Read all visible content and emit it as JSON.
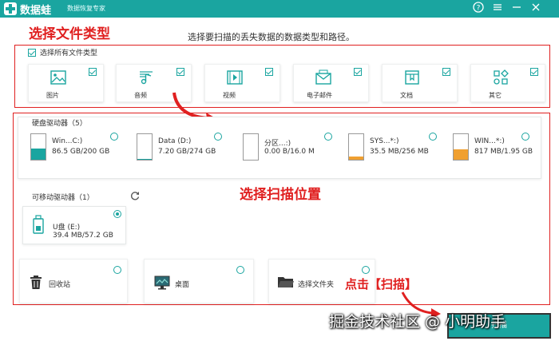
{
  "titlebar": {
    "app_name": "数据蛙",
    "subtitle": "数据恢复专家",
    "help_icon": "help-icon",
    "menu_icon": "menu-icon",
    "min_icon": "minimize-icon",
    "close_icon": "close-icon",
    "bg_color": "#1aa5a0"
  },
  "annotations": {
    "select_types": "选择文件类型",
    "select_location": "选择扫描位置",
    "click_scan": "点击【扫描】",
    "color": "#e02020"
  },
  "instruction": "选择要扫描的丢失数据的数据类型和路径。",
  "file_types": {
    "select_all_label": "选择所有文件类型",
    "select_all_checked": true,
    "items": [
      {
        "label": "图片",
        "icon": "image-icon",
        "checked": true
      },
      {
        "label": "音频",
        "icon": "music-icon",
        "checked": true
      },
      {
        "label": "视频",
        "icon": "video-icon",
        "checked": true
      },
      {
        "label": "电子邮件",
        "icon": "email-icon",
        "checked": true
      },
      {
        "label": "文档",
        "icon": "document-icon",
        "checked": true
      },
      {
        "label": "其它",
        "icon": "other-icon",
        "checked": true
      }
    ]
  },
  "hard_drives": {
    "title": "硬盘驱动器（5）",
    "items": [
      {
        "name": "Win...C:)",
        "size": "86.5 GB/200 GB",
        "used_fraction": 0.43,
        "fill_color": "#1aa5a0",
        "selected": false
      },
      {
        "name": "Data (D:)",
        "size": "7.20 GB/274 GB",
        "used_fraction": 0.03,
        "fill_color": "#1aa5a0",
        "selected": false
      },
      {
        "name": "分区...:)",
        "size": "0.00  B/16.0 M",
        "used_fraction": 0.0,
        "fill_color": "#f0a030",
        "selected": false
      },
      {
        "name": "SYS...*:)",
        "size": "35.5 MB/256 MB",
        "used_fraction": 0.14,
        "fill_color": "#f0a030",
        "selected": false
      },
      {
        "name": "WIN...*:)",
        "size": "817 MB/1.95 GB",
        "used_fraction": 0.42,
        "fill_color": "#f0a030",
        "selected": false
      }
    ]
  },
  "removable": {
    "title": "可移动驱动器（1）",
    "refresh_icon": "refresh-icon",
    "items": [
      {
        "name": "U盘 (E:)",
        "size": "39.4 MB/57.2 GB",
        "icon": "usb-drive-icon",
        "selected": true
      }
    ]
  },
  "locations": [
    {
      "label": "回收站",
      "icon": "recycle-bin-icon"
    },
    {
      "label": "桌面",
      "icon": "desktop-icon"
    },
    {
      "label": "选择文件夹",
      "icon": "folder-icon"
    }
  ],
  "scan_button": {
    "label": "扫描"
  },
  "watermark": "掘金技术社区 @ 小明助手"
}
